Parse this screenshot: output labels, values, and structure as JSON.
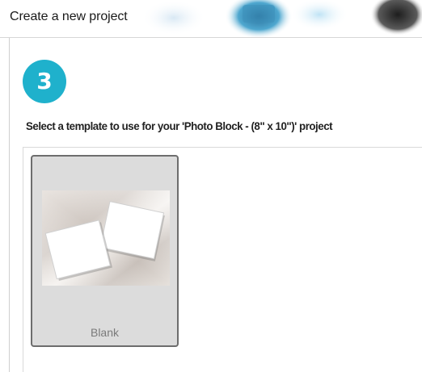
{
  "window": {
    "title": "Create a new project"
  },
  "wizard": {
    "step_number": "3",
    "instruction": "Select a template to use for your 'Photo Block - (8\" x 10\")' project"
  },
  "templates": [
    {
      "label": "Blank",
      "selected": true
    }
  ],
  "colors": {
    "step_badge": "#1fb1cc",
    "tile_background": "#dcdcdc",
    "tile_border": "#6d6d6d"
  },
  "icons": {
    "template_thumbnail": "two-overlapping-photo-frames"
  }
}
